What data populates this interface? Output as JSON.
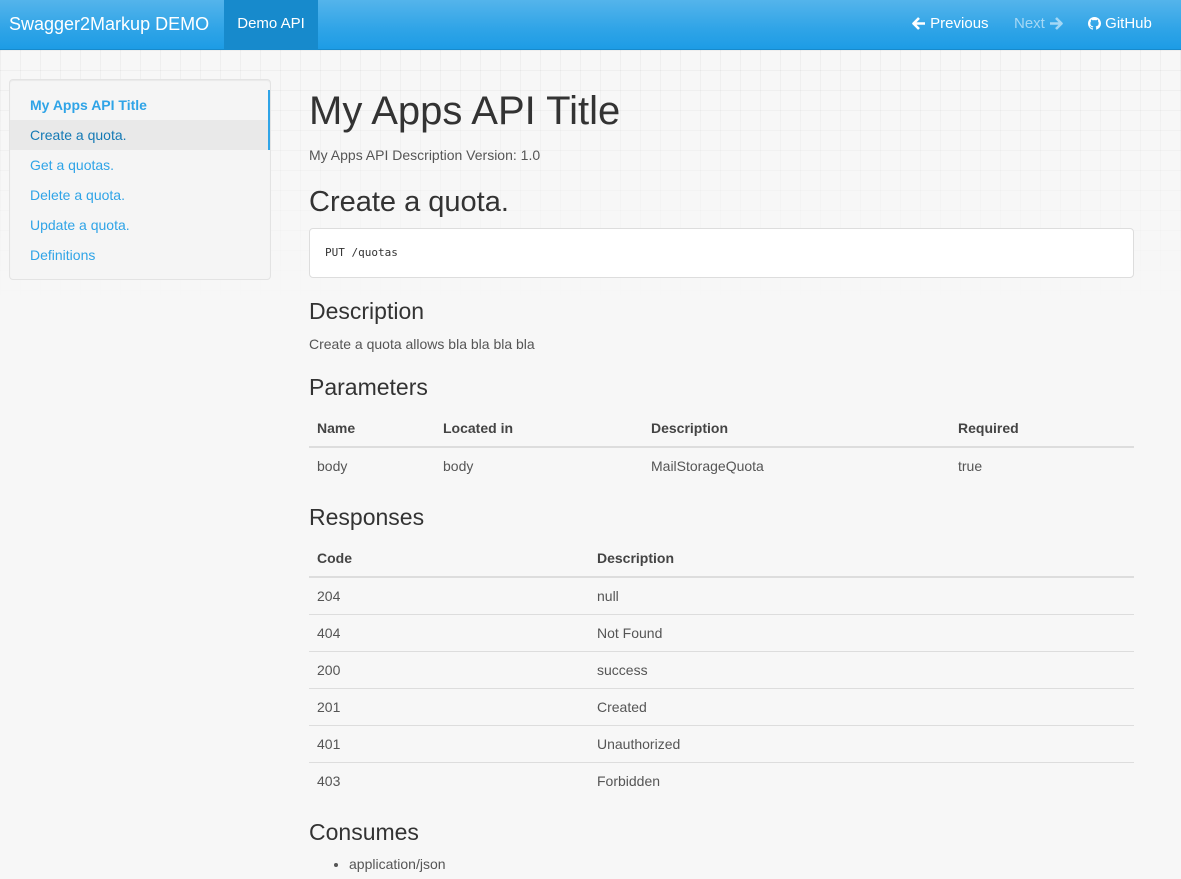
{
  "navbar": {
    "brand": "Swagger2Markup DEMO",
    "active_tab": "Demo API",
    "previous": "Previous",
    "next": "Next",
    "github": "GitHub"
  },
  "sidebar": {
    "items": [
      {
        "label": "My Apps API Title"
      },
      {
        "label": "Create a quota."
      },
      {
        "label": "Get a quotas."
      },
      {
        "label": "Delete a quota."
      },
      {
        "label": "Update a quota."
      },
      {
        "label": "Definitions"
      }
    ]
  },
  "main": {
    "title": "My Apps API Title",
    "version_line": "My Apps API Description Version: 1.0",
    "section_title": "Create a quota.",
    "endpoint": "PUT /quotas",
    "description": {
      "heading": "Description",
      "text": "Create a quota allows bla bla bla bla"
    },
    "parameters": {
      "heading": "Parameters",
      "headers": [
        "Name",
        "Located in",
        "Description",
        "Required"
      ],
      "rows": [
        [
          "body",
          "body",
          "MailStorageQuota",
          "true"
        ]
      ]
    },
    "responses": {
      "heading": "Responses",
      "headers": [
        "Code",
        "Description"
      ],
      "rows": [
        [
          "204",
          "null"
        ],
        [
          "404",
          "Not Found"
        ],
        [
          "200",
          "success"
        ],
        [
          "201",
          "Created"
        ],
        [
          "401",
          "Unauthorized"
        ],
        [
          "403",
          "Forbidden"
        ]
      ]
    },
    "consumes": {
      "heading": "Consumes",
      "items": [
        "application/json"
      ]
    }
  },
  "colors": {
    "navbar": "#2fa4e7",
    "navbar_active": "#178acc",
    "link": "#2fa4e7",
    "background": "#f7f7f7"
  }
}
